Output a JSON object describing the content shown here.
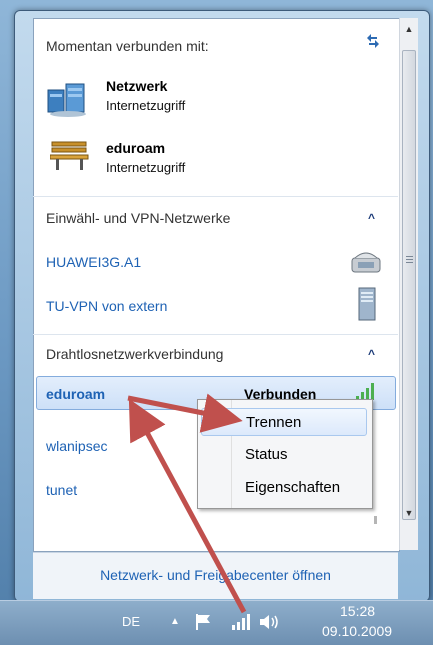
{
  "panel": {
    "header": "Momentan verbunden mit:",
    "connections": [
      {
        "name": "Netzwerk",
        "status": "Internetzugriff",
        "icon": "network-icon"
      },
      {
        "name": "eduroam",
        "status": "Internetzugriff",
        "icon": "bench-icon"
      }
    ],
    "dialup_section": {
      "title": "Einwähl- und VPN-Netzwerke",
      "items": [
        {
          "label": "HUAWEI3G.A1",
          "icon": "phone-modem-icon"
        },
        {
          "label": "TU-VPN von extern",
          "icon": "vpn-server-icon"
        }
      ]
    },
    "wireless_section": {
      "title": "Drahtlosnetzwerkverbindung",
      "items": [
        {
          "label": "eduroam",
          "status": "Verbunden",
          "selected": true
        },
        {
          "label": "wlanipsec"
        },
        {
          "label": "tunet"
        }
      ]
    },
    "footer_link": "Netzwerk- und Freigabecenter öffnen"
  },
  "context_menu": {
    "items": [
      "Trennen",
      "Status",
      "Eigenschaften"
    ]
  },
  "taskbar": {
    "language": "DE",
    "time": "15:28",
    "date": "09.10.2009"
  },
  "colors": {
    "link": "#1e62b4",
    "arrow": "#c0504d",
    "signal": "#4caf50"
  }
}
